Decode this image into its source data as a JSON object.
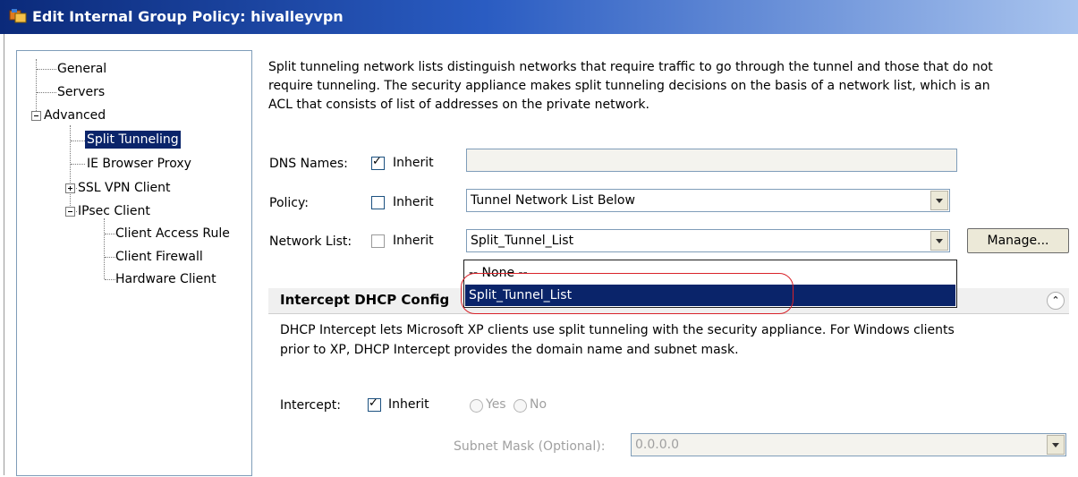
{
  "window": {
    "title": "Edit Internal Group Policy: hivalleyvpn"
  },
  "tree": {
    "items": [
      {
        "label": "General"
      },
      {
        "label": "Servers"
      },
      {
        "label": "Advanced"
      },
      {
        "label": "Split Tunneling",
        "selected": true
      },
      {
        "label": "IE Browser Proxy"
      },
      {
        "label": "SSL VPN Client"
      },
      {
        "label": "IPsec Client"
      },
      {
        "label": "Client Access Rule"
      },
      {
        "label": "Client Firewall"
      },
      {
        "label": "Hardware Client"
      }
    ]
  },
  "description": {
    "line1": "Split tunneling network lists distinguish networks that require traffic to go through the tunnel and those that do not",
    "line2": "require tunneling. The security appliance makes split tunneling decisions on the basis of a network list, which is an",
    "line3": "ACL that consists of list of addresses on the private network."
  },
  "dns": {
    "label": "DNS Names:",
    "inherit_label": "Inherit",
    "inherit_checked": true,
    "value": ""
  },
  "policy": {
    "label": "Policy:",
    "inherit_label": "Inherit",
    "inherit_checked": false,
    "value": "Tunnel Network List Below"
  },
  "network_list": {
    "label": "Network List:",
    "inherit_label": "Inherit",
    "inherit_checked": false,
    "value": "Split_Tunnel_List",
    "manage_label": "Manage...",
    "options": [
      "-- None --",
      "Split_Tunnel_List"
    ],
    "highlighted_option": "Split_Tunnel_List"
  },
  "dhcp": {
    "section_title": "Intercept DHCP Config",
    "desc_line1": "DHCP Intercept lets Microsoft XP clients use split tunneling with the security appliance. For Windows clients",
    "desc_line2": "prior to XP, DHCP Intercept provides the domain name and subnet mask.",
    "intercept_label": "Intercept:",
    "inherit_label": "Inherit",
    "inherit_checked": true,
    "yes_label": "Yes",
    "no_label": "No",
    "subnet_label": "Subnet Mask (Optional):",
    "subnet_value": "0.0.0.0"
  },
  "colors": {
    "selection": "#0a246a",
    "highlight_ring": "#d9232a",
    "title_gradient_start": "#0b2a7a"
  }
}
